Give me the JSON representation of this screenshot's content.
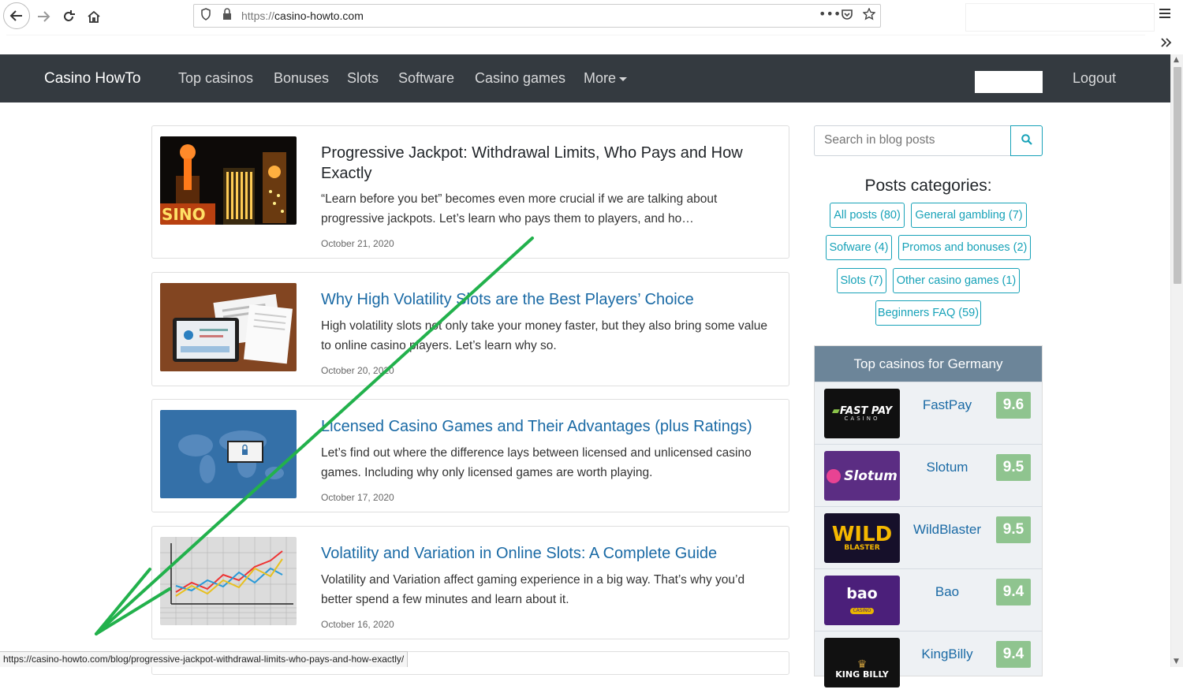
{
  "browser": {
    "url_prefix": "https://",
    "url_host": "casino-howto.com",
    "status_url": "https://casino-howto.com/blog/progressive-jackpot-withdrawal-limits-who-pays-and-how-exactly/"
  },
  "navbar": {
    "brand": "Casino HowTo",
    "links": [
      "Top casinos",
      "Bonuses",
      "Slots",
      "Software",
      "Casino games",
      "More"
    ],
    "logout": "Logout"
  },
  "posts": [
    {
      "title": "Progressive Jackpot: Withdrawal Limits, Who Pays and How Exactly",
      "excerpt": "“Learn before you bet” becomes even more crucial if we are talking about progressive jackpots. Let’s learn who pays them to players, and ho…",
      "date": "October 21, 2020"
    },
    {
      "title": "Why High Volatility Slots are the Best Players’ Choice",
      "excerpt": "High volatility slots not only take your money faster, but they also bring some value to online casino players. Let’s learn why so.",
      "date": "October 20, 2020"
    },
    {
      "title": "Licensed Casino Games and Their Advantages (plus Ratings)",
      "excerpt": "Let’s find out where the difference lays between licensed and unlicensed casino games. Including why only licensed games are worth playing.",
      "date": "October 17, 2020"
    },
    {
      "title": "Volatility and Variation in Online Slots: A Complete Guide",
      "excerpt": "Volatility and Variation affect gaming experience in a big way. That’s why you’d better spend a few minutes and learn about it.",
      "date": "October 16, 2020"
    }
  ],
  "sidebar": {
    "search_placeholder": "Search in blog posts",
    "categories_heading": "Posts categories:",
    "categories": [
      "All posts (80)",
      "General gambling (7)",
      "Sofware (4)",
      "Promos and bonuses (2)",
      "Slots (7)",
      "Other casino games (1)",
      "Beginners FAQ (59)"
    ],
    "top_casinos_heading": "Top casinos for Germany",
    "casinos": [
      {
        "name": "FastPay",
        "score": "9.6",
        "logo_text": "FAST PAY",
        "logo_sub": "CASINO"
      },
      {
        "name": "Slotum",
        "score": "9.5",
        "logo_text": "Slotum",
        "logo_sub": ""
      },
      {
        "name": "WildBlaster",
        "score": "9.5",
        "logo_text": "WILD",
        "logo_sub": "BLASTER"
      },
      {
        "name": "Bao",
        "score": "9.4",
        "logo_text": "bao",
        "logo_sub": "CASINO"
      },
      {
        "name": "KingBilly",
        "score": "9.4",
        "logo_text": "KING BILLY",
        "logo_sub": ""
      }
    ]
  },
  "colors": {
    "navbar_bg": "#343a40",
    "accent_teal": "#17a2b8",
    "link_blue": "#1a6aa5",
    "score_green": "#8fc48f",
    "casino_header": "#6c8599",
    "annotation_arrow": "#22b14c"
  }
}
